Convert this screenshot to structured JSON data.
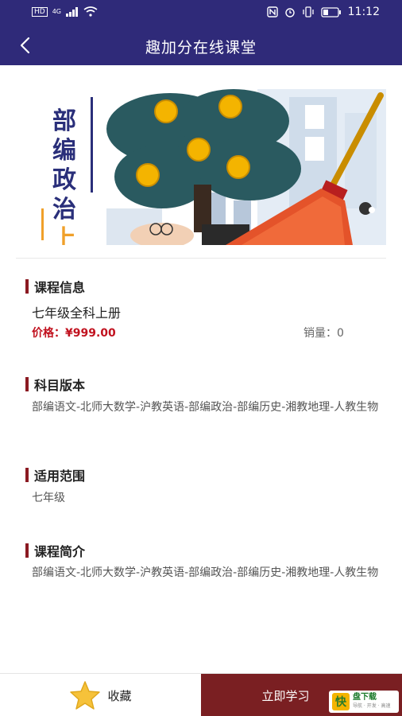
{
  "status_bar": {
    "network_left": "HD",
    "signal": "4G",
    "time": "11:12"
  },
  "nav": {
    "title": "趣加分在线课堂"
  },
  "banner": {
    "cover_chars": [
      "部",
      "编",
      "政",
      "治",
      "上"
    ],
    "cover_highlight_char": "上"
  },
  "course_info": {
    "heading": "课程信息",
    "name": "七年级全科上册",
    "price": "价格：¥999.00",
    "sales": "销量：0"
  },
  "subject_version": {
    "heading": "科目版本",
    "text": "部编语文-北师大数学-沪教英语-部编政治-部编历史-湘教地理-人教生物"
  },
  "scope": {
    "heading": "适用范围",
    "text": "七年级"
  },
  "intro": {
    "heading": "课程简介",
    "text": "部编语文-北师大数学-沪教英语-部编政治-部编历史-湘教地理-人教生物"
  },
  "bottom": {
    "favorite_label": "收藏",
    "study_label": "立即学习"
  },
  "watermark": {
    "logo_char": "快",
    "name": "盘下载",
    "sub": "导航 · 开发 · 高速"
  },
  "colors": {
    "header_bg": "#2f2a79",
    "accent_red": "#c1121f",
    "section_bar": "#8b1a22",
    "study_button": "#7a1f22"
  }
}
